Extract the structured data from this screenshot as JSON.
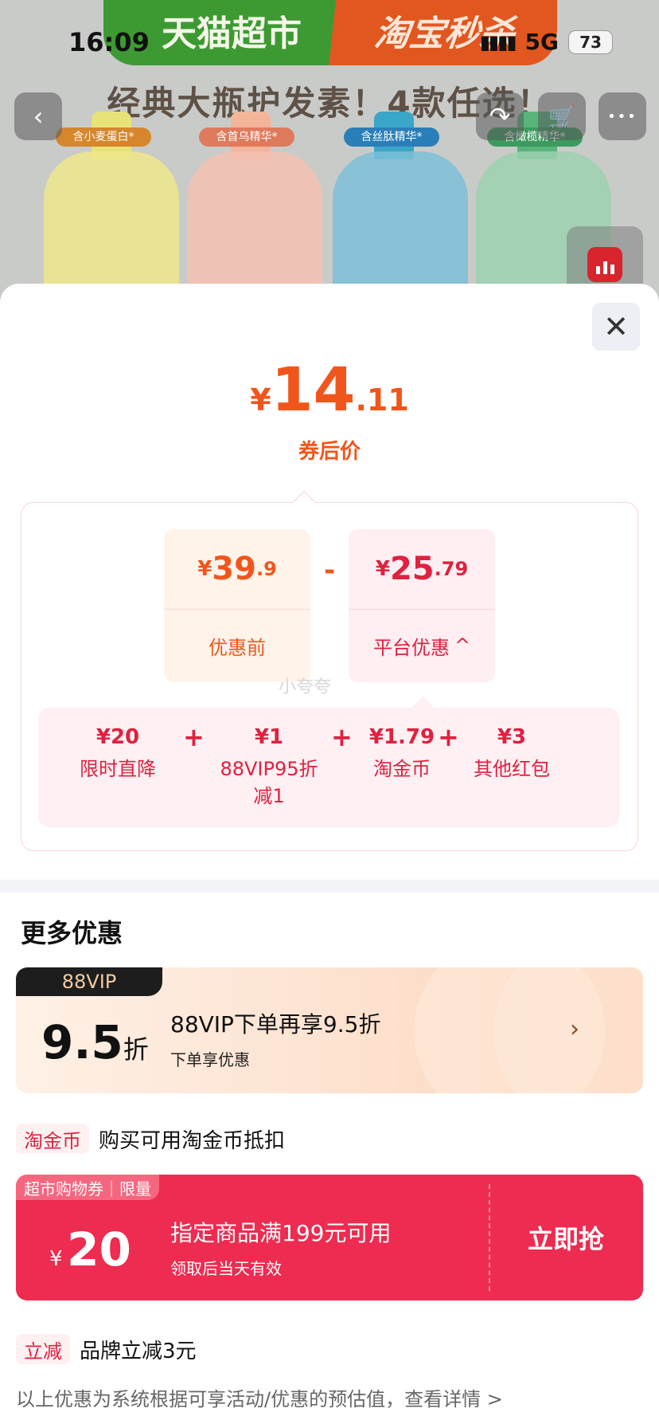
{
  "status_bar": {
    "time": "16:09",
    "signal": "▮▮▮▮",
    "network": "5G",
    "battery": "73"
  },
  "product_banner": {
    "left_text": "天猫超市",
    "right_text": "淘宝秒杀",
    "headline": "经典大瓶护发素！4款任选！",
    "bottle_tags": [
      "含小麦蛋白*",
      "含首乌精华*",
      "含丝肽精华*",
      "含橄榄精华*"
    ]
  },
  "nav": {
    "back_icon": "‹",
    "share_icon": "↷",
    "cart_icon": "🛒",
    "more_icon": "•••"
  },
  "sheet": {
    "close_icon": "✕",
    "final_price": {
      "currency": "¥",
      "integer": "14",
      "decimal": ".11",
      "label": "券后价"
    },
    "original": {
      "currency": "¥",
      "integer": "39",
      "decimal": ".9",
      "label": "优惠前"
    },
    "minus": "-",
    "platform": {
      "currency": "¥",
      "integer": "25",
      "decimal": ".79",
      "label": "平台优惠",
      "chevron": "^"
    },
    "watermark": "小夸夸",
    "discount_items": [
      {
        "value": "¥20",
        "label": "限时直降"
      },
      {
        "value": "¥1",
        "label": "88VIP95折",
        "label2": "减1"
      },
      {
        "value": "¥1.79",
        "label": "淘金币"
      },
      {
        "value": "¥3",
        "label": "其他红包"
      }
    ],
    "plus": "+"
  },
  "more": {
    "title": "更多优惠",
    "vip": {
      "tag": "88VIP",
      "discount": "9.5",
      "discount_unit": "折",
      "title": "88VIP下单再享9.5折",
      "subtitle": "下单享优惠",
      "arrow": "›"
    },
    "coin": {
      "badge": "淘金币",
      "text": "购买可用淘金币抵扣"
    },
    "coupon": {
      "tag": "超市购物券｜限量",
      "currency": "¥",
      "amount": "20",
      "condition": "指定商品满199元可用",
      "validity": "领取后当天有效",
      "action": "立即抢"
    },
    "reduce": {
      "badge": "立减",
      "text": "品牌立减3元"
    },
    "footnote": "以上优惠为系统根据可享活动/优惠的预估值，查看详情 >"
  },
  "colors": {
    "accent_orange": "#f0561c",
    "accent_red": "#e0213f",
    "coupon_red": "#ee2b50"
  }
}
